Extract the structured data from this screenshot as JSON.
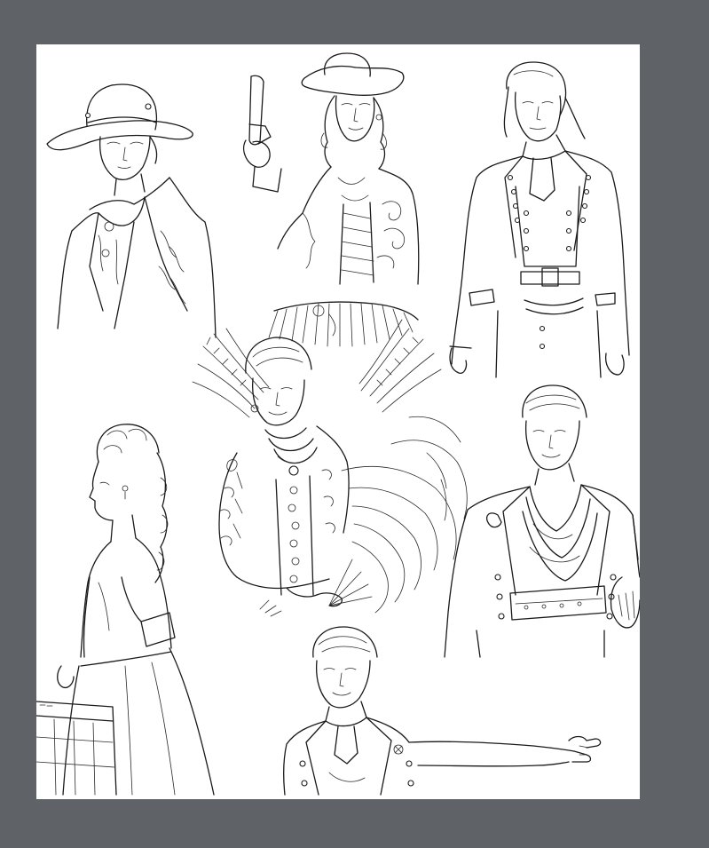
{
  "app": {
    "background_color": "#5f6368",
    "canvas_color": "#ffffff",
    "line_color": "#1a1a1a"
  },
  "figures": [
    {
      "name": "hat-woman"
    },
    {
      "name": "cowgirl-pistol"
    },
    {
      "name": "coat-man-top"
    },
    {
      "name": "wheat-fan-woman"
    },
    {
      "name": "profile-woman"
    },
    {
      "name": "scarf-man"
    },
    {
      "name": "pointing-man"
    }
  ]
}
